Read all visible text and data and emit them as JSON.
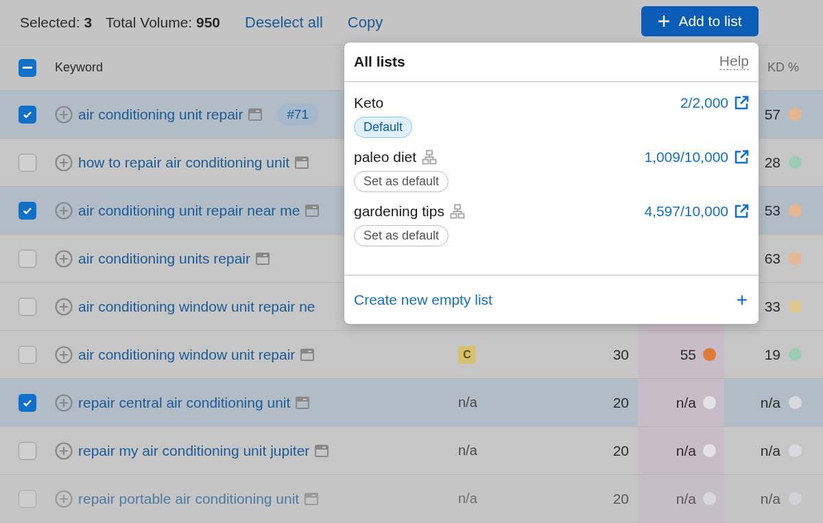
{
  "toolbar": {
    "selected_label": "Selected:",
    "selected_count": "3",
    "volume_label": "Total Volume:",
    "volume_total": "950",
    "actions": [
      "Deselect all",
      "Copy"
    ],
    "add_button": "Add to list"
  },
  "table": {
    "header": {
      "indeterminate": true,
      "keyword": "Keyword",
      "kd": "KD %"
    },
    "rows": [
      {
        "selected": true,
        "keyword": "air conditioning unit repair",
        "serp_icon": true,
        "position": "#71",
        "kd": {
          "value": "57",
          "color": "#e6b592"
        }
      },
      {
        "selected": false,
        "keyword": "how to repair air conditioning unit",
        "serp_icon": true,
        "kd": {
          "value": "28",
          "color": "#9ccbb2"
        }
      },
      {
        "selected": true,
        "keyword": "air conditioning unit repair near me",
        "serp_icon": true,
        "kd": {
          "value": "53",
          "color": "#e6b592"
        }
      },
      {
        "selected": false,
        "keyword": "air conditioning units repair",
        "serp_icon": true,
        "kd": {
          "value": "63",
          "color": "#e6b592"
        }
      },
      {
        "selected": false,
        "keyword": "air conditioning window unit repair ne",
        "serp_icon": false,
        "kd": {
          "value": "33",
          "color": "#dcc88d"
        }
      },
      {
        "selected": false,
        "keyword": "air conditioning window unit repair",
        "serp_icon": true,
        "intent": {
          "kind": "badge",
          "text": "C"
        },
        "volume": "30",
        "column_5": {
          "value": "55",
          "color": "#e07a3a"
        },
        "kd": {
          "value": "19",
          "color": "#9ccbb2"
        }
      },
      {
        "selected": true,
        "keyword": "repair central air conditioning unit",
        "serp_icon": true,
        "intent": {
          "kind": "plain",
          "text": "n/a"
        },
        "volume": "20",
        "column_5": {
          "value": "n/a",
          "color": "#e2e2e8"
        },
        "kd": {
          "value": "n/a",
          "color": "#dadade"
        }
      },
      {
        "selected": false,
        "keyword": "repair my air conditioning unit jupiter",
        "serp_icon": true,
        "intent": {
          "kind": "plain",
          "text": "n/a"
        },
        "volume": "20",
        "column_5": {
          "value": "n/a",
          "color": "#e2e2e8"
        },
        "kd": {
          "value": "n/a",
          "color": "#dadade"
        }
      },
      {
        "selected": false,
        "keyword": "repair portable air conditioning unit",
        "serp_icon": true,
        "intent": {
          "kind": "plain",
          "text": "n/a"
        },
        "volume": "20",
        "column_5": {
          "value": "n/a",
          "color": "#e2e2e8"
        },
        "kd": {
          "value": "n/a",
          "color": "#dadade"
        }
      }
    ]
  },
  "popover": {
    "title": "All lists",
    "help": "Help",
    "lists": [
      {
        "name": "Keto",
        "shared": false,
        "count": "2/2,000",
        "default": true,
        "default_label": "Default"
      },
      {
        "name": "paleo diet",
        "shared": true,
        "count": "1,009/10,000",
        "default": false,
        "default_label": "Set as default"
      },
      {
        "name": "gardening tips",
        "shared": true,
        "count": "4,597/10,000",
        "default": false,
        "default_label": "Set as default"
      }
    ],
    "create": "Create new empty list",
    "create_icon": "+"
  }
}
